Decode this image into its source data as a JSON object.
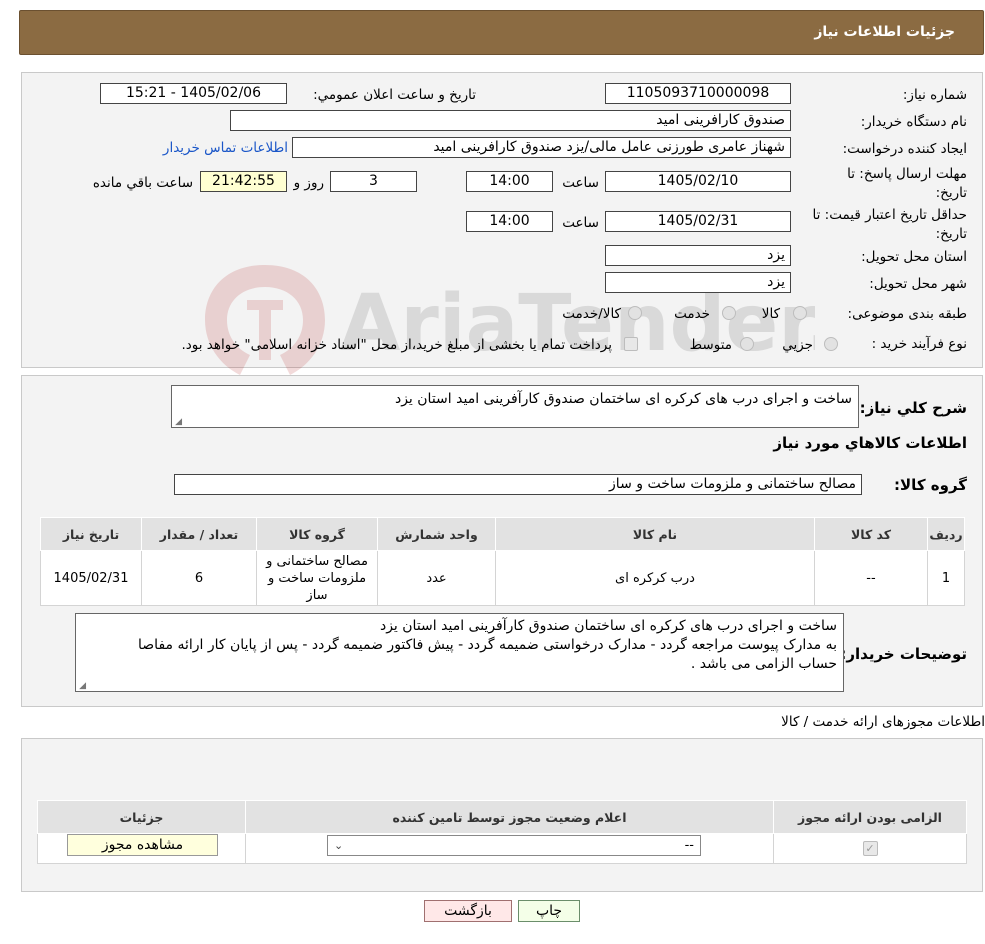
{
  "header": {
    "title": "جزئیات اطلاعات نیاز"
  },
  "need": {
    "number_label": "شماره نیاز:",
    "number": "1105093710000098",
    "announce_label": "تاریخ و ساعت اعلان عمومي:",
    "announce_value": "1405/02/06 - 15:21",
    "buyer_label": "نام دستگاه خریدار:",
    "buyer": "صندوق کارافرینی امید",
    "creator_label": "ایجاد کننده درخواست:",
    "creator": "شهناز عامری طورزنی عامل مالی/یزد صندوق کارافرینی امید",
    "contact_link": "اطلاعات تماس خريدار",
    "deadline_label": "مهلت ارسال پاسخ: تا تاریخ:",
    "deadline_date": "1405/02/10",
    "time_label": "ساعت",
    "deadline_time": "14:00",
    "days": "3",
    "days_label": "روز و",
    "remaining_time": "21:42:55",
    "remaining_label": "ساعت باقي مانده",
    "validity_label": "حداقل تاریخ اعتبار قیمت: تا تاریخ:",
    "validity_date": "1405/02/31",
    "validity_time": "14:00",
    "province_label": "استان محل تحویل:",
    "province": "یزد",
    "city_label": "شهر محل تحویل:",
    "city": "یزد",
    "category_label": "طبقه بندی موضوعی:",
    "category_options": [
      "کالا",
      "خدمت",
      "کالا/خدمت"
    ],
    "process_label": "نوع فرآیند خرید :",
    "process_options": [
      "جزیي",
      "متوسط"
    ],
    "payment_note": "پرداخت تمام یا بخشی از مبلغ خرید،از محل \"اسناد خزانه اسلامی\" خواهد بود."
  },
  "watermark": {
    "text": "AriaTender.neT"
  },
  "description": {
    "label": "شرح کلي نیاز:",
    "value": "ساخت و اجرای درب های کرکره ای ساختمان صندوق کارآفرینی امید استان یزد"
  },
  "goods": {
    "section_title": "اطلاعات کالاهاي مورد نیاز",
    "group_label": "گروه کالا:",
    "group_value": "مصالح ساختمانی و ملزومات ساخت و ساز",
    "columns": [
      "ردیف",
      "کد کالا",
      "نام کالا",
      "واحد شمارش",
      "گروه کالا",
      "تعداد / مقدار",
      "تاریخ نیاز"
    ],
    "rows": [
      [
        "1",
        "--",
        "درب کرکره ای",
        "عدد",
        "مصالح ساختمانی و ملزومات ساخت و ساز",
        "6",
        "1405/02/31"
      ]
    ]
  },
  "buyer_notes": {
    "label": "توضیحات خریدار:",
    "line1": "ساخت و اجرای درب های کرکره ای ساختمان صندوق کارآفرینی امید استان یزد",
    "line2": "به مدارک پیوست مراجعه گردد - مدارک درخواستی ضمیمه گردد - پیش فاکتور ضمیمه گردد - پس از پایان کار ارائه مفاصا",
    "line3": "حساب الزامی می باشد ."
  },
  "permits": {
    "section_title": "اطلاعات مجوزهای ارائه خدمت / کالا",
    "columns": [
      "الزامی بودن ارائه مجوز",
      "اعلام وضعیت مجوز توسط تامین کننده",
      "جزئیات"
    ],
    "select_value": "--",
    "view_button": "مشاهده مجوز"
  },
  "actions": {
    "print": "چاپ",
    "back": "بازگشت"
  }
}
